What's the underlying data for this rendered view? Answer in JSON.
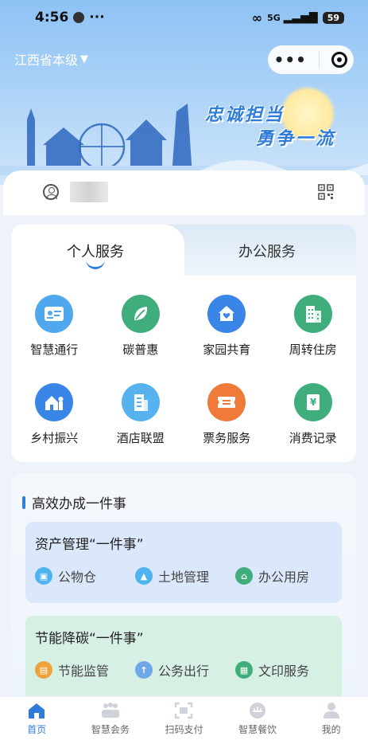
{
  "status_bar": {
    "time": "4:56",
    "dots": "···",
    "network": "5G",
    "battery": "59"
  },
  "header": {
    "region": "江西省本级",
    "region_arrow": "▼",
    "capsule_dots": "•••",
    "slogan_line1": "忠诚担当",
    "slogan_line2": "勇争一流"
  },
  "tabs": [
    {
      "label": "个人服务",
      "active": true
    },
    {
      "label": "办公服务",
      "active": false
    }
  ],
  "services": [
    {
      "label": "智慧通行",
      "icon": "id-card-icon",
      "color": "#4fa8ee"
    },
    {
      "label": "碳普惠",
      "icon": "leaf-icon",
      "color": "#3fae7c"
    },
    {
      "label": "家园共育",
      "icon": "home-heart-icon",
      "color": "#3a86e8"
    },
    {
      "label": "周转住房",
      "icon": "building-icon",
      "color": "#3fae7c"
    },
    {
      "label": "乡村振兴",
      "icon": "village-icon",
      "color": "#3a86e8"
    },
    {
      "label": "酒店联盟",
      "icon": "hotel-icon",
      "color": "#56b3ef"
    },
    {
      "label": "票务服务",
      "icon": "ticket-icon",
      "color": "#f07a3a"
    },
    {
      "label": "消费记录",
      "icon": "yuan-record-icon",
      "color": "#3fae7c"
    }
  ],
  "onething": {
    "title": "高效办成一件事",
    "asset": {
      "title": "资产管理“一件事”",
      "items": [
        {
          "label": "公物仓",
          "icon": "cube-icon",
          "color": "#4fb3f0"
        },
        {
          "label": "土地管理",
          "icon": "land-icon",
          "color": "#4fb3f0"
        },
        {
          "label": "办公用房",
          "icon": "house-icon",
          "color": "#3fae7c"
        }
      ]
    },
    "energy": {
      "title": "节能降碳“一件事”",
      "items": [
        {
          "label": "节能监管",
          "icon": "monitor-icon",
          "color": "#f0a23a"
        },
        {
          "label": "公务出行",
          "icon": "travel-icon",
          "color": "#6fa8e8"
        },
        {
          "label": "文印服务",
          "icon": "print-icon",
          "color": "#3fae7c"
        }
      ]
    }
  },
  "bottom_nav": [
    {
      "label": "首页",
      "icon": "home-icon",
      "active": true
    },
    {
      "label": "智慧会务",
      "icon": "meeting-icon",
      "active": false
    },
    {
      "label": "扫码支付",
      "icon": "scan-icon",
      "active": false
    },
    {
      "label": "智慧餐饮",
      "icon": "dining-icon",
      "active": false
    },
    {
      "label": "我的",
      "icon": "profile-icon",
      "active": false
    }
  ]
}
